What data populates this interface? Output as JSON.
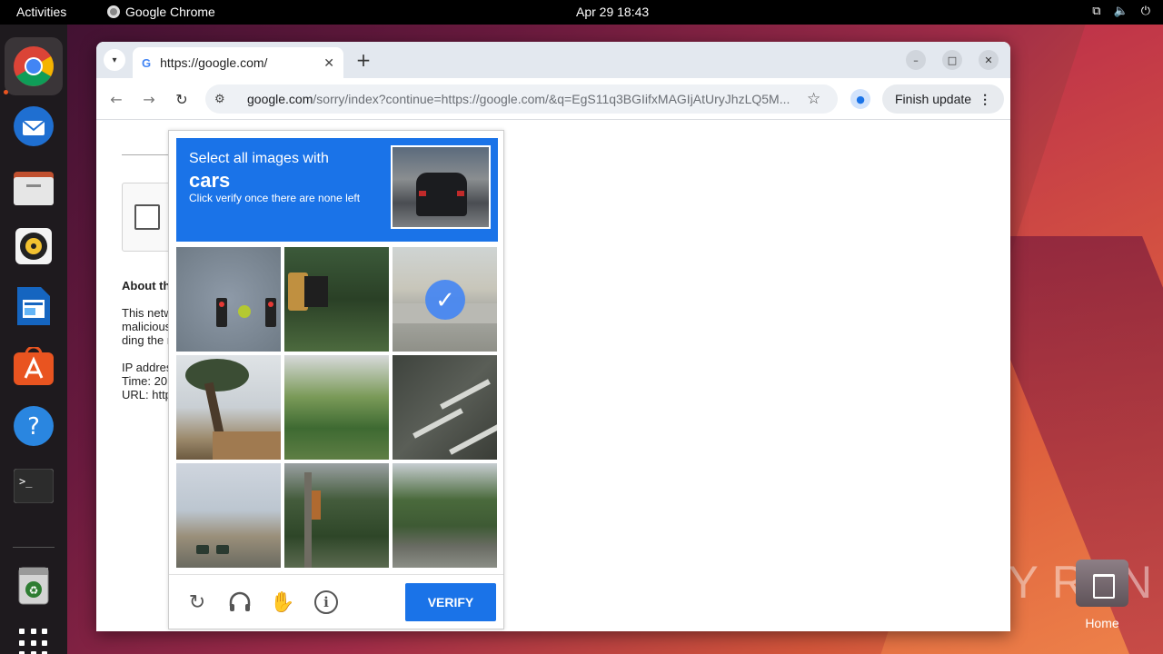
{
  "topbar": {
    "activities": "Activities",
    "app_name": "Google Chrome",
    "clock": "Apr 29  18:43",
    "tray_icons": [
      "network-icon",
      "volume-icon",
      "power-icon"
    ]
  },
  "dock": {
    "items": [
      "chrome-icon",
      "thunderbird-icon",
      "files-icon",
      "rhythmbox-icon",
      "writer-icon",
      "app-center-icon",
      "help-icon",
      "terminal-icon",
      "trash-icon",
      "show-apps-icon"
    ]
  },
  "desktop": {
    "home_label": "Home",
    "watermark": "ANY RUN"
  },
  "browser": {
    "tab": {
      "favicon": "G",
      "title": "https://google.com/",
      "close": "✕"
    },
    "new_tab": "+",
    "url_host": "google.com",
    "url_path": "/sorry/index?continue=https://google.com/&q=EgS11q3BGIifxMAGIjAtUryJhzLQ5M...",
    "finish_update": "Finish update"
  },
  "page": {
    "about_heading": "About th",
    "para_lines": [
      "This netw",
      "malicious",
      "ding the r"
    ],
    "meta_lines": [
      "IP addres",
      "Time: 20",
      "URL: http"
    ]
  },
  "captcha": {
    "prompt": "Select all images with",
    "object": "cars",
    "instruction": "Click verify once there are none left",
    "tiles": [
      {
        "content": "traffic lights with leaves",
        "selected": false
      },
      {
        "content": "traffic light in trees",
        "selected": false
      },
      {
        "content": "concrete wall",
        "selected": true
      },
      {
        "content": "palm tree and house",
        "selected": false
      },
      {
        "content": "palm trees",
        "selected": false
      },
      {
        "content": "road markings",
        "selected": false
      },
      {
        "content": "road with cars",
        "selected": false
      },
      {
        "content": "traffic light pole in trees",
        "selected": false
      },
      {
        "content": "hill with road",
        "selected": false
      }
    ],
    "verify_label": "VERIFY",
    "accent_color": "#1a73e8"
  }
}
